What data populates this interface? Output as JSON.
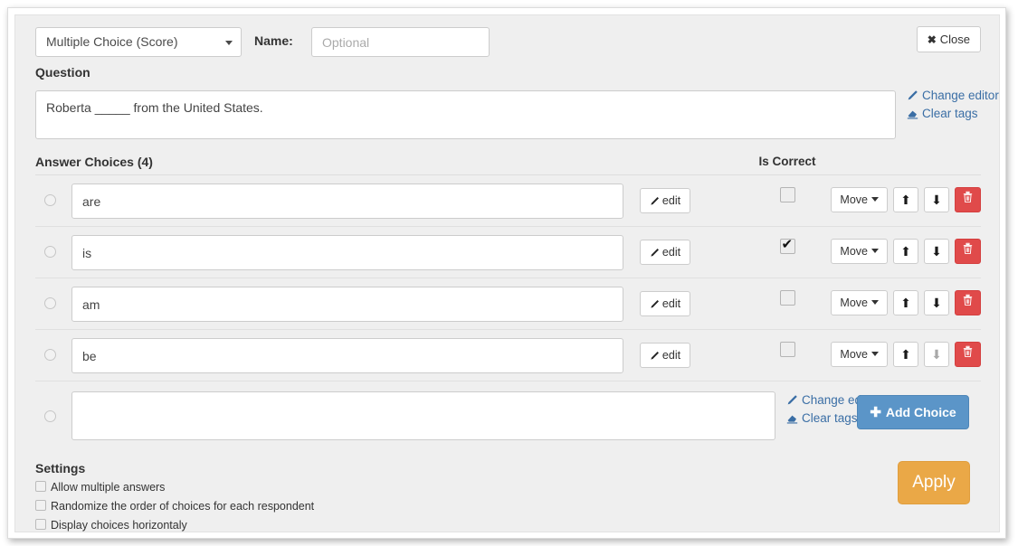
{
  "header": {
    "question_type": "Multiple Choice (Score)",
    "name_label": "Name:",
    "name_value": "",
    "name_placeholder": "Optional",
    "close_label": "Close",
    "close_glyph": "✖"
  },
  "question": {
    "section_label": "Question",
    "text": "Roberta _____ from the United States.",
    "change_editor_label": "Change editor",
    "clear_tags_label": "Clear tags"
  },
  "answers": {
    "section_label": "Answer Choices (4)",
    "is_correct_label": "Is Correct",
    "edit_label": "edit",
    "move_label": "Move",
    "up_glyph": "⬆",
    "down_glyph": "⬇",
    "choices": [
      {
        "text": "are",
        "is_correct": false
      },
      {
        "text": "is",
        "is_correct": true
      },
      {
        "text": "am",
        "is_correct": false
      },
      {
        "text": "be",
        "is_correct": false
      }
    ]
  },
  "new_choice": {
    "text": "",
    "change_editor_label": "Change editor",
    "clear_tags_label": "Clear tags",
    "add_choice_label": "Add Choice",
    "plus_glyph": "➕"
  },
  "settings": {
    "section_label": "Settings",
    "options": [
      {
        "label": "Allow multiple answers",
        "checked": false
      },
      {
        "label": "Randomize the order of choices for each respondent",
        "checked": false
      },
      {
        "label": "Display choices horizontaly",
        "checked": false
      }
    ],
    "apply_label": "Apply"
  },
  "colors": {
    "panel_bg": "#efefef",
    "link_blue": "#3a6ea5",
    "add_choice_blue": "#5b95c8",
    "delete_red": "#e04a4a",
    "apply_orange": "#eaa847"
  }
}
